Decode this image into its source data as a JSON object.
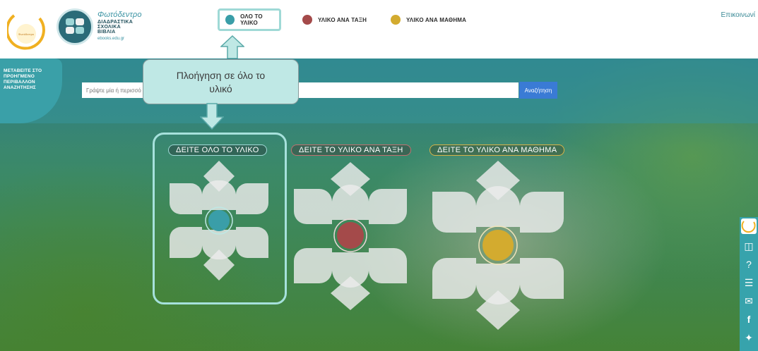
{
  "header": {
    "logo_title": "Φωτόδεντρο",
    "logo_sub_lines": [
      "ΔΙΑΔΡΑΣΤΙΚΑ",
      "ΣΧΟΛΙΚΑ",
      "ΒΙΒΛΙΑ"
    ],
    "logo_url": "ebooks.edu.gr",
    "nav": [
      {
        "label": "ΟΛΟ ΤΟ ΥΛΙΚΟ",
        "color": "#3a9ea8"
      },
      {
        "label": "ΥΛΙΚΟ ΑΝΑ ΤΑΞΗ",
        "color": "#a44a4a"
      },
      {
        "label": "ΥΛΙΚΟ ΑΝΑ ΜΑΘΗΜΑ",
        "color": "#d3ab2f"
      }
    ],
    "contact": "Επικοινωνί"
  },
  "search": {
    "left_tab_lines": [
      "ΜΕΤΑΒΕΙΤΕ ΣΤΟ",
      "ΠΡΟΗΓΜΕΝΟ",
      "ΠΕΡΙΒΑΛΛΟΝ",
      "ΑΝΑΖΗΤΗΣΗΣ"
    ],
    "placeholder": "Γράψτε μία ή περισσό",
    "button": "Αναζήτηση"
  },
  "tooltip": {
    "line1": "Πλοήγηση σε όλο το",
    "line2": "υλικό"
  },
  "cards": [
    {
      "label": "ΔΕΙΤΕ ΟΛΟ ΤΟ ΥΛΙΚΟ",
      "color": "#3a9ea8"
    },
    {
      "label": "ΔΕΙΤΕ ΤΟ ΥΛΙΚΟ ΑΝΑ ΤΑΞΗ",
      "color": "#a44a4a"
    },
    {
      "label": "ΔΕΙΤΕ ΤΟ ΥΛΙΚΟ ΑΝΑ ΜΑΘΗΜΑ",
      "color": "#d3ab2f"
    }
  ],
  "sidebar_icons": [
    "sun-logo-icon",
    "book-icon",
    "help-icon",
    "document-icon",
    "mail-icon",
    "facebook-icon",
    "twitter-icon"
  ],
  "colors": {
    "accent_teal": "#3aa0a8",
    "highlight": "#a6e1dc",
    "search_button": "#3a7bd5"
  }
}
